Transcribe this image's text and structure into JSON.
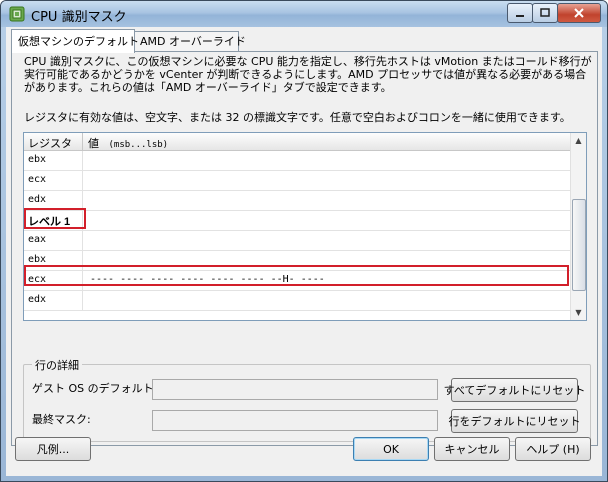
{
  "window": {
    "title": "CPU 識別マスク"
  },
  "tabs": [
    {
      "label": "仮想マシンのデフォルト",
      "active": true
    },
    {
      "label": "AMD オーバーライド",
      "active": false
    }
  ],
  "description": "CPU 識別マスクに、この仮想マシンに必要な CPU 能力を指定し、移行先ホストは vMotion またはコールド移行が実行可能であるかどうかを vCenter が判断できるようにします。AMD プロセッサでは値が異なる必要がある場合があります。これらの値は「AMD オーバーライド」タブで設定できます。",
  "note": "レジスタに有効な値は、空文字、または 32 の標識文字です。任意で空白およびコロンを一緒に使用できます。",
  "grid": {
    "columns": [
      "レジスタ",
      "値"
    ],
    "value_format_hint": "(msb...lsb)",
    "rows": [
      {
        "register": "ebx",
        "value": ""
      },
      {
        "register": "ecx",
        "value": ""
      },
      {
        "register": "edx",
        "value": ""
      },
      {
        "register": "レベル 1",
        "value": "",
        "is_level": true
      },
      {
        "register": "eax",
        "value": ""
      },
      {
        "register": "ebx",
        "value": ""
      },
      {
        "register": "ecx",
        "value": "---- ---- ---- ---- ---- ---- --H- ----",
        "highlighted": true
      },
      {
        "register": "edx",
        "value": ""
      }
    ]
  },
  "details": {
    "group_label": "行の詳細",
    "guest_os_default_label": "ゲスト OS のデフォルト:",
    "guest_os_default_value": "",
    "final_mask_label": "最終マスク:",
    "final_mask_value": "",
    "reset_all_button": "すべてデフォルトにリセット",
    "reset_row_button": "行をデフォルトにリセット"
  },
  "footer": {
    "legend_button": "凡例...",
    "ok_button": "OK",
    "cancel_button": "キャンセル",
    "help_button": "ヘルプ (H)"
  },
  "colors": {
    "highlight_border": "#d21f2a",
    "title_gradient": "#a8c4e2"
  },
  "icons": [
    "vsphere-app-icon",
    "minimize-icon",
    "maximize-icon",
    "close-icon",
    "scroll-up-icon",
    "scroll-down-icon"
  ]
}
